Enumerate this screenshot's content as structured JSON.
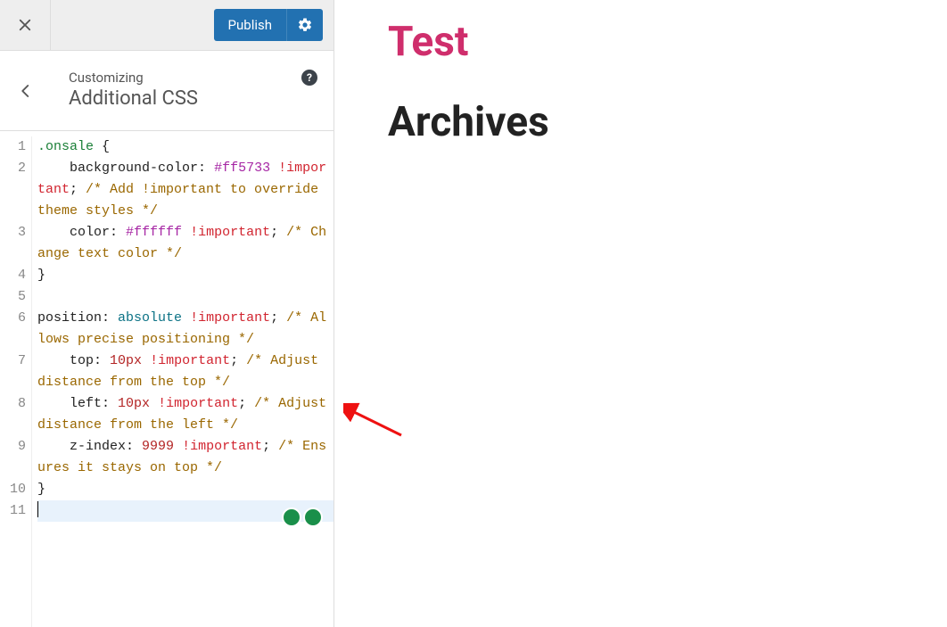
{
  "topbar": {
    "publish_label": "Publish"
  },
  "header": {
    "eyebrow": "Customizing",
    "title": "Additional CSS",
    "help_char": "?"
  },
  "editor": {
    "lines": [
      {
        "num": 1,
        "tokens": [
          {
            "cls": "t-sel",
            "t": ".onsale"
          },
          {
            "cls": "t-punc",
            "t": " {"
          }
        ]
      },
      {
        "num": 2,
        "tokens": [
          {
            "cls": "",
            "t": "    "
          },
          {
            "cls": "t-prop",
            "t": "background-color"
          },
          {
            "cls": "t-punc",
            "t": ": "
          },
          {
            "cls": "t-hex",
            "t": "#ff5733"
          },
          {
            "cls": "",
            "t": " "
          },
          {
            "cls": "t-imp",
            "t": "!important"
          },
          {
            "cls": "t-punc",
            "t": "; "
          },
          {
            "cls": "t-comm",
            "t": "/* Add !important to override theme styles */"
          }
        ]
      },
      {
        "num": 3,
        "tokens": [
          {
            "cls": "",
            "t": "    "
          },
          {
            "cls": "t-prop",
            "t": "color"
          },
          {
            "cls": "t-punc",
            "t": ": "
          },
          {
            "cls": "t-hex",
            "t": "#ffffff"
          },
          {
            "cls": "",
            "t": " "
          },
          {
            "cls": "t-imp",
            "t": "!important"
          },
          {
            "cls": "t-punc",
            "t": "; "
          },
          {
            "cls": "t-comm",
            "t": "/* Change text color */"
          }
        ]
      },
      {
        "num": 4,
        "tokens": [
          {
            "cls": "t-punc",
            "t": "}"
          }
        ]
      },
      {
        "num": 5,
        "tokens": [
          {
            "cls": "",
            "t": ""
          }
        ]
      },
      {
        "num": 6,
        "tokens": [
          {
            "cls": "t-prop",
            "t": "position"
          },
          {
            "cls": "t-punc",
            "t": ": "
          },
          {
            "cls": "t-val",
            "t": "absolute"
          },
          {
            "cls": "",
            "t": " "
          },
          {
            "cls": "t-imp",
            "t": "!important"
          },
          {
            "cls": "t-punc",
            "t": "; "
          },
          {
            "cls": "t-comm",
            "t": "/* Allows precise positioning */"
          }
        ]
      },
      {
        "num": 7,
        "tokens": [
          {
            "cls": "",
            "t": "    "
          },
          {
            "cls": "t-prop",
            "t": "top"
          },
          {
            "cls": "t-punc",
            "t": ": "
          },
          {
            "cls": "t-num",
            "t": "10px"
          },
          {
            "cls": "",
            "t": " "
          },
          {
            "cls": "t-imp",
            "t": "!important"
          },
          {
            "cls": "t-punc",
            "t": "; "
          },
          {
            "cls": "t-comm",
            "t": "/* Adjust distance from the top */"
          }
        ]
      },
      {
        "num": 8,
        "tokens": [
          {
            "cls": "",
            "t": "    "
          },
          {
            "cls": "t-prop",
            "t": "left"
          },
          {
            "cls": "t-punc",
            "t": ": "
          },
          {
            "cls": "t-num",
            "t": "10px"
          },
          {
            "cls": "",
            "t": " "
          },
          {
            "cls": "t-imp",
            "t": "!important"
          },
          {
            "cls": "t-punc",
            "t": "; "
          },
          {
            "cls": "t-comm",
            "t": "/* Adjust distance from the left */"
          }
        ]
      },
      {
        "num": 9,
        "tokens": [
          {
            "cls": "",
            "t": "    "
          },
          {
            "cls": "t-prop",
            "t": "z-index"
          },
          {
            "cls": "t-punc",
            "t": ": "
          },
          {
            "cls": "t-num",
            "t": "9999"
          },
          {
            "cls": "",
            "t": " "
          },
          {
            "cls": "t-imp",
            "t": "!important"
          },
          {
            "cls": "t-punc",
            "t": "; "
          },
          {
            "cls": "t-comm",
            "t": "/* Ensures it stays on top */"
          }
        ]
      },
      {
        "num": 10,
        "tokens": [
          {
            "cls": "t-punc",
            "t": "}"
          }
        ]
      },
      {
        "num": 11,
        "active": true,
        "tokens": [
          {
            "cls": "",
            "t": ""
          }
        ]
      }
    ]
  },
  "preview": {
    "site_title": "Test",
    "heading": "Archives"
  }
}
